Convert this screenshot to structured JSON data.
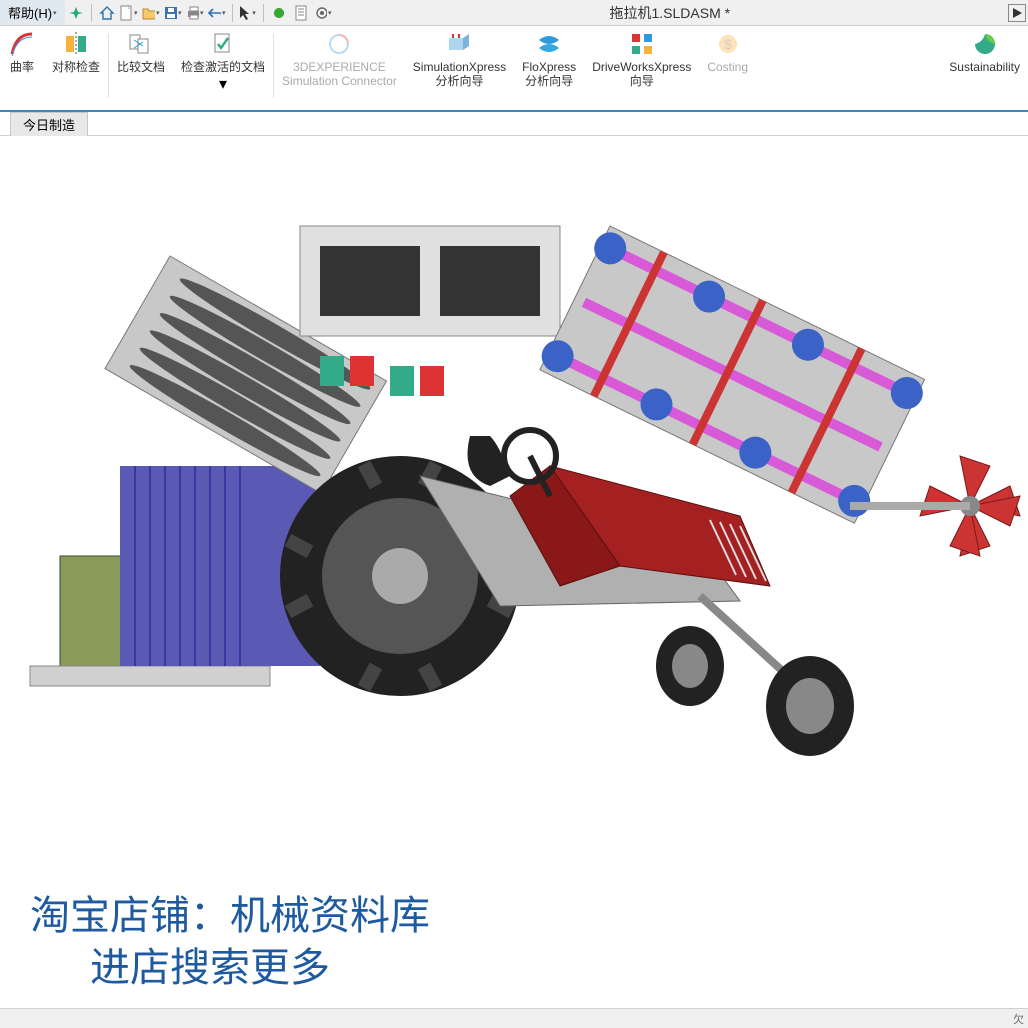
{
  "menu": {
    "help": "帮助(H)",
    "title": "拖拉机1.SLDASM *"
  },
  "qat_icons": [
    "pin-icon",
    "home-icon",
    "new-icon",
    "open-icon",
    "save-icon",
    "print-icon",
    "undo-icon",
    "select-icon",
    "rebuild-icon",
    "options-icon",
    "settings-icon"
  ],
  "ribbon": {
    "items": [
      {
        "name": "curvature-button",
        "label": "曲率",
        "grey": false,
        "icon": "curvature-icon"
      },
      {
        "name": "symmetry-check-button",
        "label": "对称检查",
        "grey": false,
        "icon": "symmetry-icon"
      },
      {
        "name": "compare-docs-button",
        "label": "比较文档",
        "grey": false,
        "icon": "compare-icon"
      },
      {
        "name": "check-active-doc-button",
        "label": "检查激活的文档",
        "grey": false,
        "icon": "check-doc-icon",
        "dropdown": true
      },
      {
        "name": "3dexperience-button",
        "label": "3DEXPERIENCE\nSimulation Connector",
        "grey": true,
        "icon": "3dx-icon"
      },
      {
        "name": "simulationxpress-button",
        "label": "SimulationXpress\n分析向导",
        "grey": false,
        "icon": "simx-icon"
      },
      {
        "name": "floxpress-button",
        "label": "FloXpress\n分析向导",
        "grey": false,
        "icon": "flox-icon"
      },
      {
        "name": "driveworksxpress-button",
        "label": "DriveWorksXpress\n向导",
        "grey": false,
        "icon": "dwx-icon"
      },
      {
        "name": "costing-button",
        "label": "Costing",
        "grey": true,
        "icon": "costing-icon"
      },
      {
        "name": "sustainability-button",
        "label": "Sustainability",
        "grey": false,
        "icon": "sustain-icon"
      }
    ]
  },
  "tab": {
    "label": "今日制造"
  },
  "viewbar_icons": [
    "zoom-fit-icon",
    "zoom-area-icon",
    "section-icon",
    "view-orient-icon",
    "display-style-icon",
    "hide-show-icon",
    "scene-icon",
    "edit-appearance-icon",
    "apply-scene-icon",
    "view-settings-icon"
  ],
  "watermark": {
    "line1": "淘宝店铺：机械资料库",
    "line2": "进店搜索更多"
  },
  "statusbar": {
    "text": "欠"
  }
}
